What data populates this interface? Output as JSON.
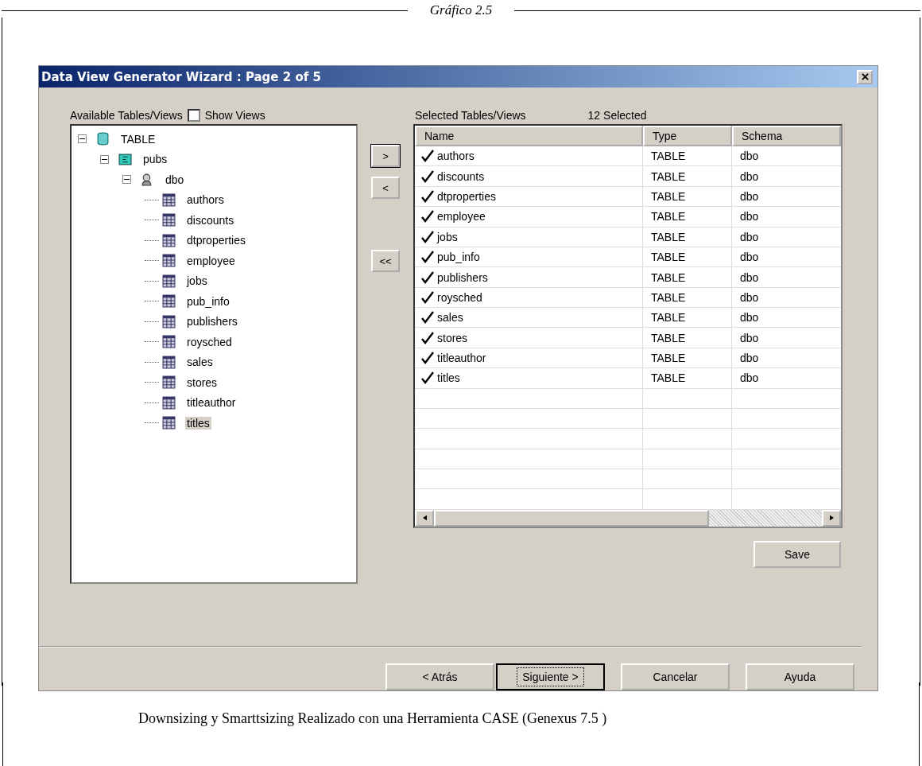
{
  "figure_title": "Gráfico 2.5",
  "window": {
    "title": "Data View Generator Wizard : Page 2 of 5"
  },
  "available": {
    "label": "Available Tables/Views",
    "show_views": {
      "label": "Show Views",
      "checked": false
    },
    "tree": [
      {
        "label": "TABLE",
        "kind": "database",
        "expanded": true,
        "selected": false,
        "children": [
          {
            "label": "pubs",
            "kind": "catalog",
            "expanded": true,
            "selected": false,
            "children": [
              {
                "label": "dbo",
                "kind": "owner",
                "expanded": true,
                "selected": false,
                "children": [
                  {
                    "label": "authors",
                    "kind": "table",
                    "selected": false
                  },
                  {
                    "label": "discounts",
                    "kind": "table",
                    "selected": false
                  },
                  {
                    "label": "dtproperties",
                    "kind": "table",
                    "selected": false
                  },
                  {
                    "label": "employee",
                    "kind": "table",
                    "selected": false
                  },
                  {
                    "label": "jobs",
                    "kind": "table",
                    "selected": false
                  },
                  {
                    "label": "pub_info",
                    "kind": "table",
                    "selected": false
                  },
                  {
                    "label": "publishers",
                    "kind": "table",
                    "selected": false
                  },
                  {
                    "label": "roysched",
                    "kind": "table",
                    "selected": false
                  },
                  {
                    "label": "sales",
                    "kind": "table",
                    "selected": false
                  },
                  {
                    "label": "stores",
                    "kind": "table",
                    "selected": false
                  },
                  {
                    "label": "titleauthor",
                    "kind": "table",
                    "selected": false
                  },
                  {
                    "label": "titles",
                    "kind": "table",
                    "selected": true
                  }
                ]
              }
            ]
          }
        ]
      }
    ]
  },
  "move_buttons": [
    ">",
    "<",
    "<<"
  ],
  "selected": {
    "label": "Selected Tables/Views",
    "count": "12 Selected",
    "columns": [
      "Name",
      "Type",
      "Schema"
    ],
    "rows": [
      {
        "name": "authors",
        "type": "TABLE",
        "schema": "dbo",
        "checked": true
      },
      {
        "name": "discounts",
        "type": "TABLE",
        "schema": "dbo",
        "checked": true
      },
      {
        "name": "dtproperties",
        "type": "TABLE",
        "schema": "dbo",
        "checked": true
      },
      {
        "name": "employee",
        "type": "TABLE",
        "schema": "dbo",
        "checked": true
      },
      {
        "name": "jobs",
        "type": "TABLE",
        "schema": "dbo",
        "checked": true
      },
      {
        "name": "pub_info",
        "type": "TABLE",
        "schema": "dbo",
        "checked": true
      },
      {
        "name": "publishers",
        "type": "TABLE",
        "schema": "dbo",
        "checked": true
      },
      {
        "name": "roysched",
        "type": "TABLE",
        "schema": "dbo",
        "checked": true
      },
      {
        "name": "sales",
        "type": "TABLE",
        "schema": "dbo",
        "checked": true
      },
      {
        "name": "stores",
        "type": "TABLE",
        "schema": "dbo",
        "checked": true
      },
      {
        "name": "titleauthor",
        "type": "TABLE",
        "schema": "dbo",
        "checked": true
      },
      {
        "name": "titles",
        "type": "TABLE",
        "schema": "dbo",
        "checked": true
      }
    ]
  },
  "save_button": "Save",
  "footer_buttons": [
    {
      "label": "< Atrás",
      "default": false
    },
    {
      "label": "Siguiente >",
      "default": true
    },
    {
      "label": "Cancelar",
      "default": false
    },
    {
      "label": "Ayuda",
      "default": false
    }
  ],
  "caption": "Downsizing y Smarttsizing Realizado con una Herramienta CASE (Genexus 7.5 )"
}
